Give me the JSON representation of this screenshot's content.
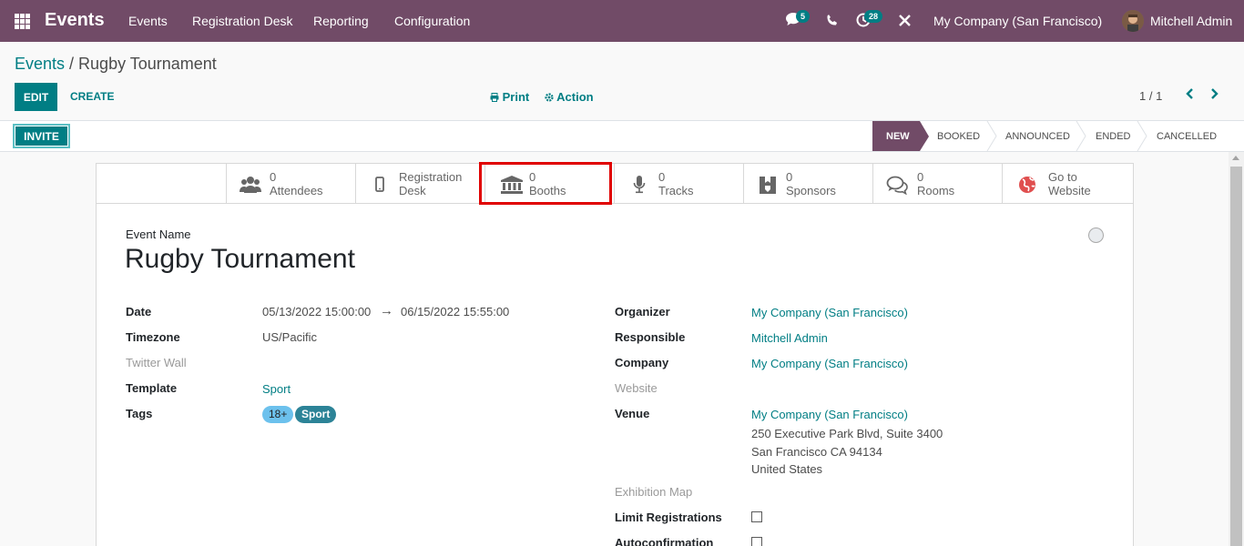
{
  "navbar": {
    "app_name": "Events",
    "menu": [
      "Events",
      "Registration Desk",
      "Reporting",
      "Configuration"
    ],
    "messages_count": "5",
    "activities_count": "28",
    "company": "My Company (San Francisco)",
    "user": "Mitchell Admin",
    "accent_color": "#714B67"
  },
  "breadcrumb": {
    "parent": "Events",
    "separator": " / ",
    "current": "Rugby Tournament"
  },
  "toolbar": {
    "edit_label": "EDIT",
    "create_label": "CREATE",
    "print_label": "Print",
    "action_label": "Action",
    "pager": "1 / 1"
  },
  "statusbar": {
    "invite_label": "INVITE",
    "stages": [
      "NEW",
      "BOOKED",
      "ANNOUNCED",
      "ENDED",
      "CANCELLED"
    ],
    "active_stage": "NEW"
  },
  "smart_buttons": [
    {
      "value": "0",
      "label": "Attendees",
      "icon": "users-icon"
    },
    {
      "value": "Registration",
      "label": "Desk",
      "icon": "mobile-icon"
    },
    {
      "value": "0",
      "label": "Booths",
      "icon": "bank-icon"
    },
    {
      "value": "0",
      "label": "Tracks",
      "icon": "microphone-icon"
    },
    {
      "value": "0",
      "label": "Sponsors",
      "icon": "badge-icon"
    },
    {
      "value": "0",
      "label": "Rooms",
      "icon": "comments-icon"
    },
    {
      "value": "Go to",
      "label": "Website",
      "icon": "globe-icon"
    }
  ],
  "form": {
    "event_name_label": "Event Name",
    "event_name": "Rugby Tournament",
    "left": {
      "date_label": "Date",
      "date_start": "05/13/2022 15:00:00",
      "date_arrow": "→",
      "date_end": "06/15/2022 15:55:00",
      "timezone_label": "Timezone",
      "timezone": "US/Pacific",
      "twitter_label": "Twitter Wall",
      "template_label": "Template",
      "template": "Sport",
      "tags_label": "Tags",
      "tags": [
        "18+",
        "Sport"
      ]
    },
    "right": {
      "organizer_label": "Organizer",
      "organizer": "My Company (San Francisco)",
      "responsible_label": "Responsible",
      "responsible": "Mitchell Admin",
      "company_label": "Company",
      "company": "My Company (San Francisco)",
      "website_label": "Website",
      "venue_label": "Venue",
      "venue_name": "My Company (San Francisco)",
      "venue_line1": "250 Executive Park Blvd, Suite 3400",
      "venue_line2": "San Francisco CA 94134",
      "venue_line3": "United States",
      "exhibition_label": "Exhibition Map",
      "limit_label": "Limit Registrations",
      "autoconfirm_label": "Autoconfirmation"
    }
  }
}
